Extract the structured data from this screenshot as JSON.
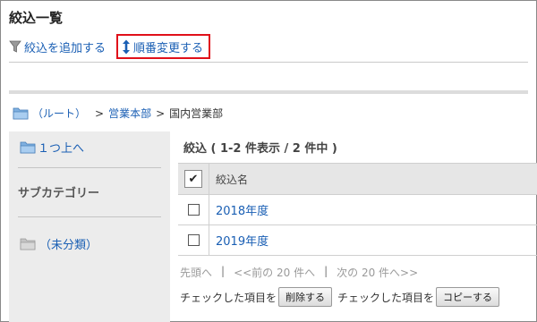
{
  "page": {
    "title": "絞込一覧"
  },
  "toolbar": {
    "add_filter": "絞込を追加する",
    "change_order": "順番変更する"
  },
  "breadcrumb": {
    "root": "（ルート）",
    "sep": ">",
    "level1": "営業本部",
    "current": "国内営業部"
  },
  "sidebar": {
    "up_label": "１つ上へ",
    "heading": "サブカテゴリー",
    "uncategorized": "（未分類）"
  },
  "list": {
    "heading": "絞込 ( 1-2 件表示 / 2 件中 )",
    "column_name": "絞込名",
    "rows": [
      {
        "name": "2018年度"
      },
      {
        "name": "2019年度"
      }
    ]
  },
  "pager": {
    "first": "先頭へ",
    "sep": "|",
    "prev": "<<前の 20 件へ",
    "next": "次の 20 件へ>>"
  },
  "bulk": {
    "label1": "チェックした項目を",
    "delete_button": "削除する",
    "label2": "チェックした項目を",
    "copy_button": "コピーする"
  },
  "colors": {
    "link": "#1a5fb4",
    "highlight_border": "#e0101a"
  }
}
